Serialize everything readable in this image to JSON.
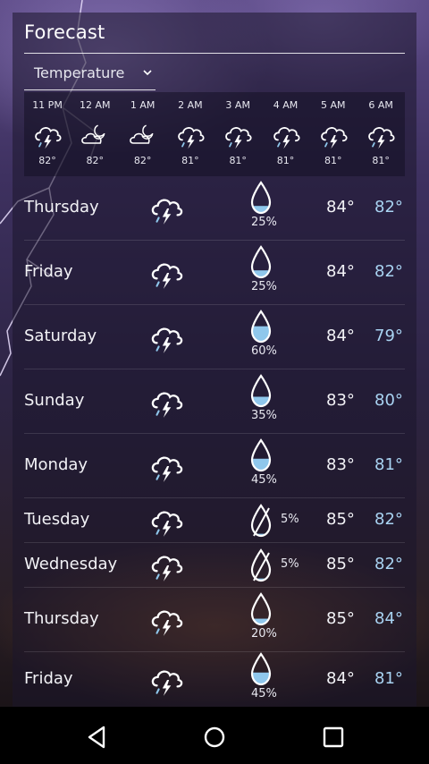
{
  "header": {
    "title": "Forecast",
    "dropdown_label": "Temperature"
  },
  "hourly": [
    {
      "time": "11 PM",
      "temp": "82°",
      "icon": "thunderstorm-icon"
    },
    {
      "time": "12 AM",
      "temp": "82°",
      "icon": "partly-cloudy-night-icon"
    },
    {
      "time": "1 AM",
      "temp": "82°",
      "icon": "partly-cloudy-night-icon"
    },
    {
      "time": "2 AM",
      "temp": "81°",
      "icon": "thunderstorm-icon"
    },
    {
      "time": "3 AM",
      "temp": "81°",
      "icon": "thunderstorm-icon"
    },
    {
      "time": "4 AM",
      "temp": "81°",
      "icon": "thunderstorm-icon"
    },
    {
      "time": "5 AM",
      "temp": "81°",
      "icon": "thunderstorm-icon"
    },
    {
      "time": "6 AM",
      "temp": "81°",
      "icon": "thunderstorm-icon"
    }
  ],
  "daily": [
    {
      "day": "Thursday",
      "precip": "25%",
      "precip_fraction": 0.25,
      "high": "84°",
      "low": "82°",
      "icon": "thunderstorm-icon"
    },
    {
      "day": "Friday",
      "precip": "25%",
      "precip_fraction": 0.25,
      "high": "84°",
      "low": "82°",
      "icon": "thunderstorm-icon"
    },
    {
      "day": "Saturday",
      "precip": "60%",
      "precip_fraction": 0.6,
      "high": "84°",
      "low": "79°",
      "icon": "thunderstorm-icon"
    },
    {
      "day": "Sunday",
      "precip": "35%",
      "precip_fraction": 0.35,
      "high": "83°",
      "low": "80°",
      "icon": "thunderstorm-icon"
    },
    {
      "day": "Monday",
      "precip": "45%",
      "precip_fraction": 0.45,
      "high": "83°",
      "low": "81°",
      "icon": "thunderstorm-icon"
    },
    {
      "day": "Tuesday",
      "precip": "5%",
      "precip_fraction": 0.05,
      "high": "85°",
      "low": "82°",
      "icon": "thunderstorm-icon"
    },
    {
      "day": "Wednesday",
      "precip": "5%",
      "precip_fraction": 0.05,
      "high": "85°",
      "low": "82°",
      "icon": "thunderstorm-icon"
    },
    {
      "day": "Thursday",
      "precip": "20%",
      "precip_fraction": 0.2,
      "high": "85°",
      "low": "84°",
      "icon": "thunderstorm-icon"
    },
    {
      "day": "Friday",
      "precip": "45%",
      "precip_fraction": 0.45,
      "high": "84°",
      "low": "81°",
      "icon": "thunderstorm-icon"
    }
  ],
  "navbar": {
    "back": "back-icon",
    "home": "home-icon",
    "recents": "recents-icon"
  },
  "colors": {
    "low_temp": "#a9d3f2",
    "rain_fill": "#8fc7ec"
  }
}
